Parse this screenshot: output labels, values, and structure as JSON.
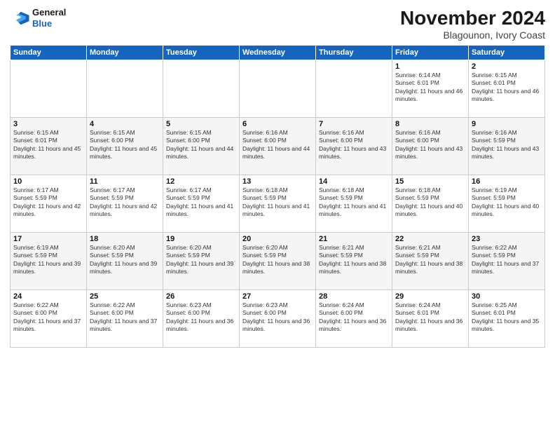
{
  "logo": {
    "line1": "General",
    "line2": "Blue"
  },
  "title": "November 2024",
  "subtitle": "Blagounon, Ivory Coast",
  "days_of_week": [
    "Sunday",
    "Monday",
    "Tuesday",
    "Wednesday",
    "Thursday",
    "Friday",
    "Saturday"
  ],
  "weeks": [
    [
      {
        "day": "",
        "info": ""
      },
      {
        "day": "",
        "info": ""
      },
      {
        "day": "",
        "info": ""
      },
      {
        "day": "",
        "info": ""
      },
      {
        "day": "",
        "info": ""
      },
      {
        "day": "1",
        "info": "Sunrise: 6:14 AM\nSunset: 6:01 PM\nDaylight: 11 hours and 46 minutes."
      },
      {
        "day": "2",
        "info": "Sunrise: 6:15 AM\nSunset: 6:01 PM\nDaylight: 11 hours and 46 minutes."
      }
    ],
    [
      {
        "day": "3",
        "info": "Sunrise: 6:15 AM\nSunset: 6:01 PM\nDaylight: 11 hours and 45 minutes."
      },
      {
        "day": "4",
        "info": "Sunrise: 6:15 AM\nSunset: 6:00 PM\nDaylight: 11 hours and 45 minutes."
      },
      {
        "day": "5",
        "info": "Sunrise: 6:15 AM\nSunset: 6:00 PM\nDaylight: 11 hours and 44 minutes."
      },
      {
        "day": "6",
        "info": "Sunrise: 6:16 AM\nSunset: 6:00 PM\nDaylight: 11 hours and 44 minutes."
      },
      {
        "day": "7",
        "info": "Sunrise: 6:16 AM\nSunset: 6:00 PM\nDaylight: 11 hours and 43 minutes."
      },
      {
        "day": "8",
        "info": "Sunrise: 6:16 AM\nSunset: 6:00 PM\nDaylight: 11 hours and 43 minutes."
      },
      {
        "day": "9",
        "info": "Sunrise: 6:16 AM\nSunset: 5:59 PM\nDaylight: 11 hours and 43 minutes."
      }
    ],
    [
      {
        "day": "10",
        "info": "Sunrise: 6:17 AM\nSunset: 5:59 PM\nDaylight: 11 hours and 42 minutes."
      },
      {
        "day": "11",
        "info": "Sunrise: 6:17 AM\nSunset: 5:59 PM\nDaylight: 11 hours and 42 minutes."
      },
      {
        "day": "12",
        "info": "Sunrise: 6:17 AM\nSunset: 5:59 PM\nDaylight: 11 hours and 41 minutes."
      },
      {
        "day": "13",
        "info": "Sunrise: 6:18 AM\nSunset: 5:59 PM\nDaylight: 11 hours and 41 minutes."
      },
      {
        "day": "14",
        "info": "Sunrise: 6:18 AM\nSunset: 5:59 PM\nDaylight: 11 hours and 41 minutes."
      },
      {
        "day": "15",
        "info": "Sunrise: 6:18 AM\nSunset: 5:59 PM\nDaylight: 11 hours and 40 minutes."
      },
      {
        "day": "16",
        "info": "Sunrise: 6:19 AM\nSunset: 5:59 PM\nDaylight: 11 hours and 40 minutes."
      }
    ],
    [
      {
        "day": "17",
        "info": "Sunrise: 6:19 AM\nSunset: 5:59 PM\nDaylight: 11 hours and 39 minutes."
      },
      {
        "day": "18",
        "info": "Sunrise: 6:20 AM\nSunset: 5:59 PM\nDaylight: 11 hours and 39 minutes."
      },
      {
        "day": "19",
        "info": "Sunrise: 6:20 AM\nSunset: 5:59 PM\nDaylight: 11 hours and 39 minutes."
      },
      {
        "day": "20",
        "info": "Sunrise: 6:20 AM\nSunset: 5:59 PM\nDaylight: 11 hours and 38 minutes."
      },
      {
        "day": "21",
        "info": "Sunrise: 6:21 AM\nSunset: 5:59 PM\nDaylight: 11 hours and 38 minutes."
      },
      {
        "day": "22",
        "info": "Sunrise: 6:21 AM\nSunset: 5:59 PM\nDaylight: 11 hours and 38 minutes."
      },
      {
        "day": "23",
        "info": "Sunrise: 6:22 AM\nSunset: 5:59 PM\nDaylight: 11 hours and 37 minutes."
      }
    ],
    [
      {
        "day": "24",
        "info": "Sunrise: 6:22 AM\nSunset: 6:00 PM\nDaylight: 11 hours and 37 minutes."
      },
      {
        "day": "25",
        "info": "Sunrise: 6:22 AM\nSunset: 6:00 PM\nDaylight: 11 hours and 37 minutes."
      },
      {
        "day": "26",
        "info": "Sunrise: 6:23 AM\nSunset: 6:00 PM\nDaylight: 11 hours and 36 minutes."
      },
      {
        "day": "27",
        "info": "Sunrise: 6:23 AM\nSunset: 6:00 PM\nDaylight: 11 hours and 36 minutes."
      },
      {
        "day": "28",
        "info": "Sunrise: 6:24 AM\nSunset: 6:00 PM\nDaylight: 11 hours and 36 minutes."
      },
      {
        "day": "29",
        "info": "Sunrise: 6:24 AM\nSunset: 6:01 PM\nDaylight: 11 hours and 36 minutes."
      },
      {
        "day": "30",
        "info": "Sunrise: 6:25 AM\nSunset: 6:01 PM\nDaylight: 11 hours and 35 minutes."
      }
    ]
  ]
}
